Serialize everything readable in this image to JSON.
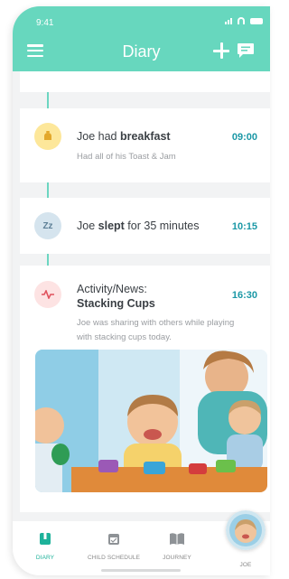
{
  "status": {
    "time": "9:41"
  },
  "header": {
    "title": "Diary",
    "menu_icon": "menu-icon",
    "add_icon": "plus-icon",
    "message_icon": "message-icon",
    "color": "#67d7be"
  },
  "events": [
    {
      "icon": "breakfast-icon",
      "title_prefix": "Joe had ",
      "title_bold": "breakfast",
      "time": "09:00",
      "description": "Had all of his Toast & Jam"
    },
    {
      "icon": "sleep-icon",
      "icon_text": "Zz",
      "title_prefix": "Joe ",
      "title_bold": "slept",
      "title_suffix": " for 35 minutes",
      "time": "10:15"
    },
    {
      "icon": "activity-icon",
      "title_line1": "Activity/News:",
      "title_line2": "Stacking Cups",
      "time": "16:30",
      "description_line1": "Joe was sharing with others while playing",
      "description_line2": "with stacking cups today.",
      "photo": "photo-of-children-playing-with-stacking-cups"
    }
  ],
  "nav": [
    {
      "label": "DIARY",
      "icon": "diary-icon",
      "active": true
    },
    {
      "label": "CHILD SCHEDULE",
      "icon": "calendar-icon",
      "active": false
    },
    {
      "label": "JOURNEY",
      "icon": "book-icon",
      "active": false
    },
    {
      "label": "JOE",
      "icon": "avatar",
      "active": false
    }
  ],
  "colors": {
    "accent": "#67d7be",
    "time_text": "#1b98a6",
    "nav_active": "#1db29a"
  }
}
